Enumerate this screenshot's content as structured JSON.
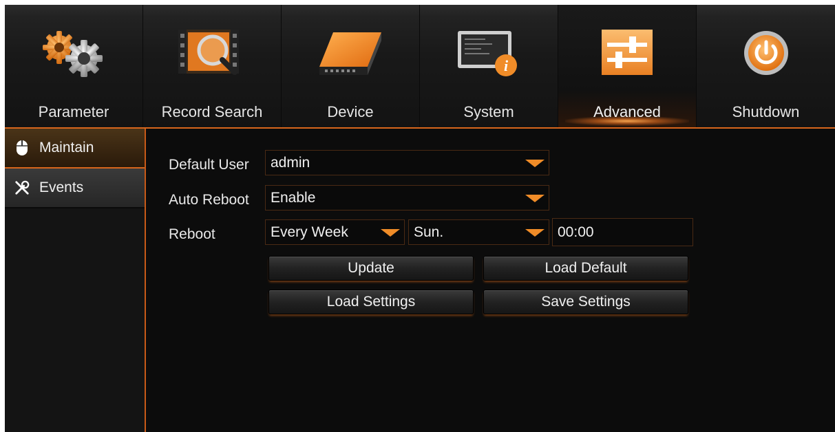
{
  "nav": {
    "items": [
      {
        "label": "Parameter",
        "icon": "gears-icon"
      },
      {
        "label": "Record Search",
        "icon": "film-search-icon"
      },
      {
        "label": "Device",
        "icon": "hard-drive-icon"
      },
      {
        "label": "System",
        "icon": "monitor-info-icon"
      },
      {
        "label": "Advanced",
        "icon": "sliders-icon",
        "active": true
      },
      {
        "label": "Shutdown",
        "icon": "power-icon"
      }
    ]
  },
  "sidebar": {
    "items": [
      {
        "label": "Maintain",
        "icon": "mouse-icon",
        "active": true
      },
      {
        "label": "Events",
        "icon": "tools-icon"
      }
    ]
  },
  "form": {
    "default_user": {
      "label": "Default User",
      "value": "admin"
    },
    "auto_reboot": {
      "label": "Auto Reboot",
      "value": "Enable"
    },
    "reboot": {
      "label": "Reboot",
      "frequency": "Every Week",
      "day": "Sun.",
      "time": "00:00"
    }
  },
  "buttons": {
    "update": "Update",
    "load_default": "Load Default",
    "load_settings": "Load Settings",
    "save_settings": "Save Settings"
  },
  "colors": {
    "accent": "#f08c28",
    "accent_line": "#d9661c",
    "background": "#0c0c0c"
  }
}
